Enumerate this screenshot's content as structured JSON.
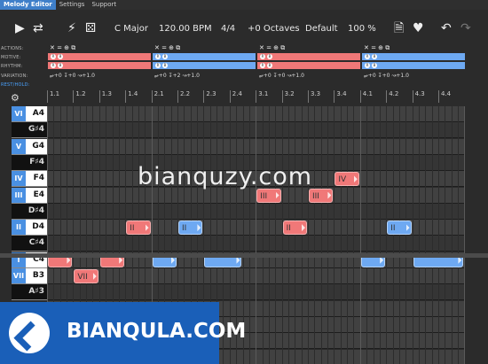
{
  "tabs": [
    {
      "label": "Melody Editor",
      "active": true
    },
    {
      "label": "Settings",
      "active": false
    },
    {
      "label": "Support",
      "active": false
    }
  ],
  "toolbar": {
    "key": "C Major",
    "tempo": "120.00 BPM",
    "time_signature": "4/4",
    "octaves": "+0 Octaves",
    "preset": "Default",
    "zoom": "100 %"
  },
  "motif_panel": {
    "row_labels": [
      "ACTIONS:",
      "MOTIVE:",
      "RHYTHM:",
      "VARIATION:",
      "REST/HOLD:"
    ],
    "blocks": [
      {
        "actions": "✕ = ⊕ ⧉",
        "variation": "⥂+0 ↧+0 ↝+1.0",
        "color": "red"
      },
      {
        "actions": "✕ = ⊕ ⧉",
        "variation": "⥂+0 ↧+2 ↝+1.0",
        "color": "blue"
      },
      {
        "actions": "✕ = ⊕ ⧉",
        "variation": "⥂+0 ↧+0 ↝+1.0",
        "color": "red"
      },
      {
        "actions": "✕ = ⊕ ⧉",
        "variation": "⥂+0 ↧+0 ↝+1.0",
        "color": "blue"
      }
    ]
  },
  "ruler": [
    "1.1",
    "1.2",
    "1.3",
    "1.4",
    "2.1",
    "2.2",
    "2.3",
    "2.4",
    "3.1",
    "3.2",
    "3.3",
    "3.4",
    "4.1",
    "4.2",
    "4.3",
    "4.4"
  ],
  "keys": [
    {
      "degree": "VI",
      "note": "A4",
      "black": false
    },
    {
      "degree": "",
      "note": "G♯4",
      "black": true
    },
    {
      "degree": "V",
      "note": "G4",
      "black": false
    },
    {
      "degree": "",
      "note": "F♯4",
      "black": true
    },
    {
      "degree": "IV",
      "note": "F4",
      "black": false
    },
    {
      "degree": "III",
      "note": "E4",
      "black": false
    },
    {
      "degree": "",
      "note": "D♯4",
      "black": true
    },
    {
      "degree": "II",
      "note": "D4",
      "black": false
    },
    {
      "degree": "",
      "note": "C♯4",
      "black": true
    },
    {
      "degree": "I",
      "note": "C4",
      "black": false
    },
    {
      "degree": "VII",
      "note": "B3",
      "black": false
    },
    {
      "degree": "",
      "note": "A♯3",
      "black": true
    }
  ],
  "notes": [
    {
      "label": "",
      "color": "red"
    },
    {
      "label": "",
      "color": "red"
    },
    {
      "label": "VII",
      "color": "red"
    },
    {
      "label": "II",
      "color": "red"
    },
    {
      "label": "II",
      "color": "blue"
    },
    {
      "label": "",
      "color": "blue"
    },
    {
      "label": "",
      "color": "blue"
    },
    {
      "label": "III",
      "color": "red"
    },
    {
      "label": "II",
      "color": "red"
    },
    {
      "label": "III",
      "color": "red"
    },
    {
      "label": "IV",
      "color": "red"
    },
    {
      "label": "II",
      "color": "blue"
    },
    {
      "label": "",
      "color": "blue"
    },
    {
      "label": "",
      "color": "blue"
    }
  ],
  "watermarks": {
    "top": "bianquzy.com",
    "bottom": "BIANQULA.COM"
  }
}
